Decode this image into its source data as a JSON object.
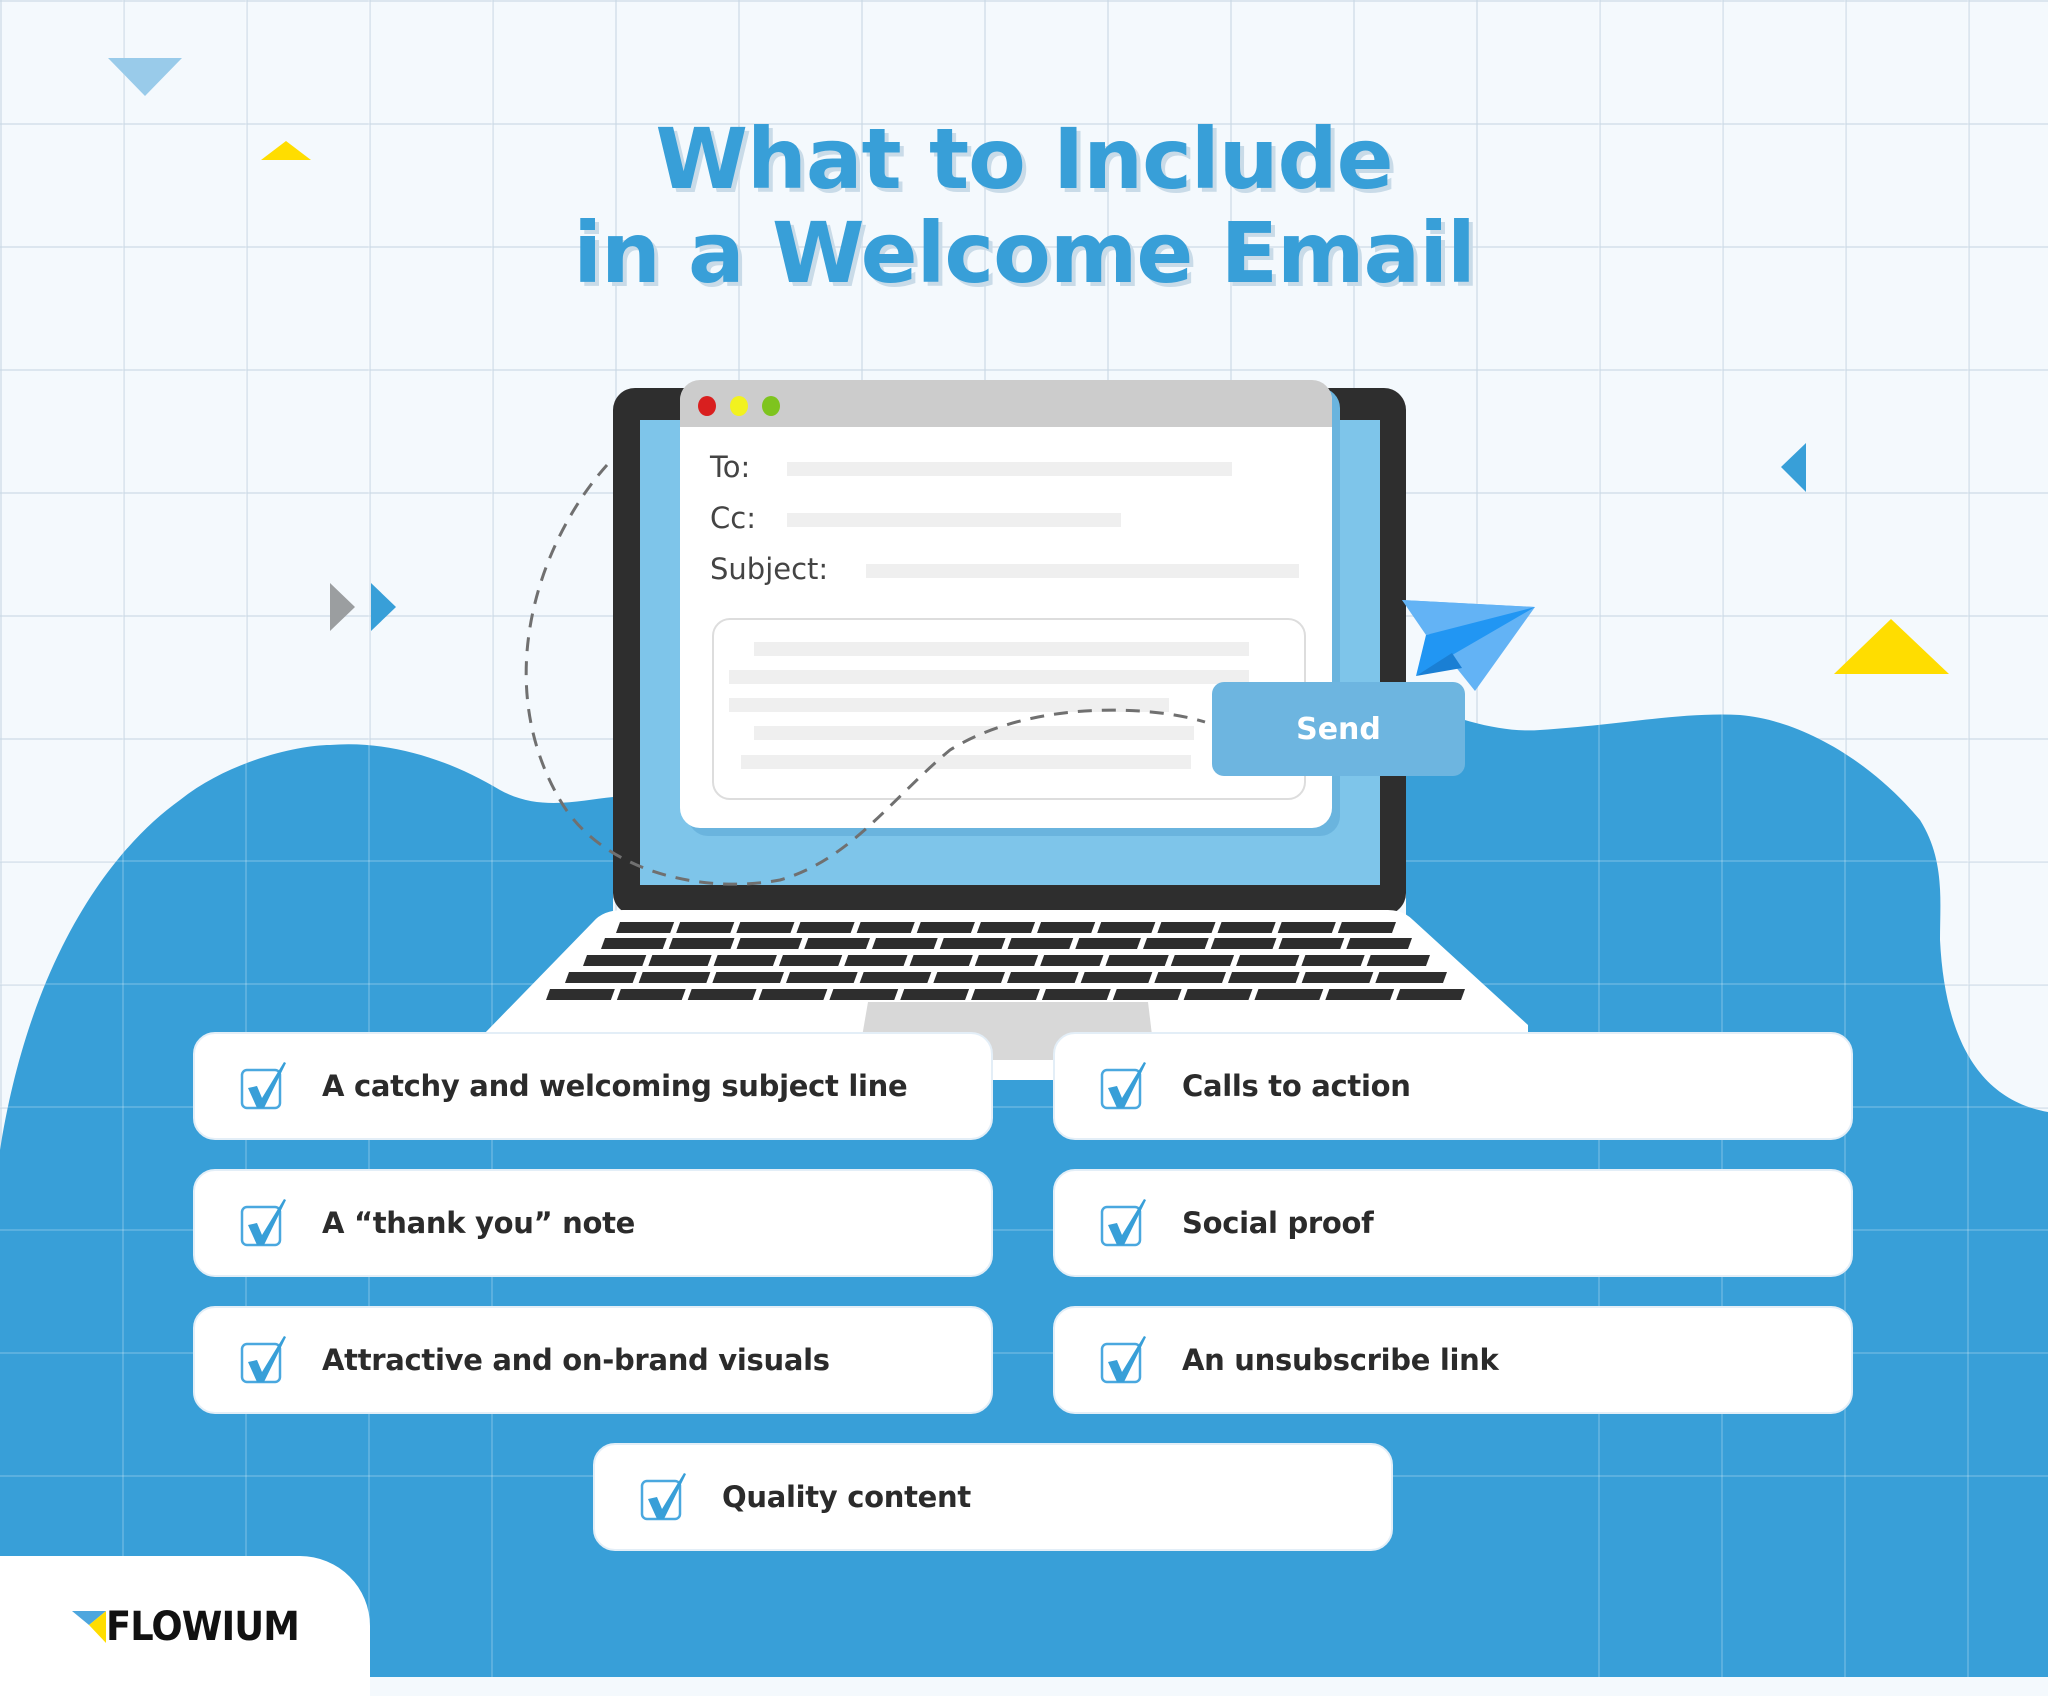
{
  "title": {
    "line1": "What to Include",
    "line2": "in a Welcome Email"
  },
  "email_window": {
    "to_label": "To:",
    "cc_label": "Cc:",
    "subject_label": "Subject:",
    "send_label": "Send",
    "traffic_lights": [
      "#d91f1f",
      "#f2f21f",
      "#7ec41e"
    ]
  },
  "checklist": [
    {
      "label": "A catchy and welcoming subject line",
      "checked": true
    },
    {
      "label": "Calls to action",
      "checked": true
    },
    {
      "label": "A “thank you” note",
      "checked": true
    },
    {
      "label": "Social proof",
      "checked": true
    },
    {
      "label": "Attractive and on-brand visuals",
      "checked": true
    },
    {
      "label": "An unsubscribe link",
      "checked": true
    },
    {
      "label": "Quality content",
      "checked": true
    }
  ],
  "brand": {
    "name": "FLOWIUM"
  },
  "colors": {
    "primary_blue": "#389fd8",
    "light_blue": "#7ec5ea",
    "yellow": "#ffdd00",
    "background": "#f4f9fd",
    "text_dark": "#2b2b2b"
  }
}
